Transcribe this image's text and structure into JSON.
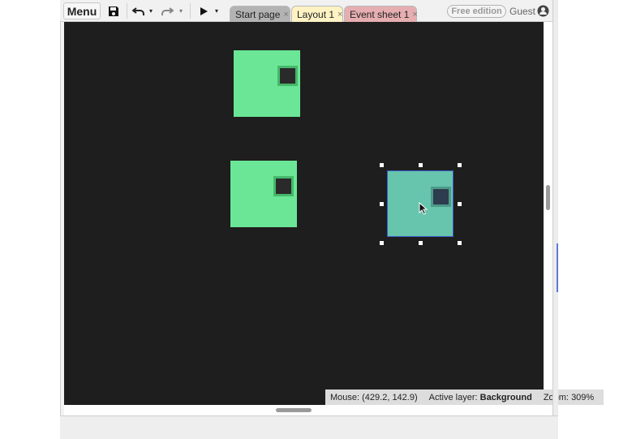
{
  "toolbar": {
    "menu_label": "Menu",
    "save_icon": "save-icon",
    "undo_icon": "undo-icon",
    "redo_icon": "redo-icon",
    "play_icon": "play-icon",
    "dropdown_glyph": "▾"
  },
  "tabs": [
    {
      "label": "Start page",
      "color": "#b3b3b3"
    },
    {
      "label": "Layout 1",
      "color": "#fff3c4",
      "active": true
    },
    {
      "label": "Event sheet 1",
      "color": "#e6aeb0"
    }
  ],
  "tab_close_glyph": "×",
  "edition_badge": "Free edition",
  "user": {
    "label": "Guest",
    "icon": "user-icon"
  },
  "canvas": {
    "background": "#1e1e1e",
    "sprite_color": "#6be696",
    "selected_sprite_color": "#66c5ac",
    "selection_color": "#3c58c8"
  },
  "status": {
    "mouse_label": "Mouse:",
    "mouse_value": "(429.2, 142.9)",
    "layer_label": "Active layer:",
    "layer_value": "Background",
    "zoom_label": "Zoom:",
    "zoom_value": "309%"
  }
}
